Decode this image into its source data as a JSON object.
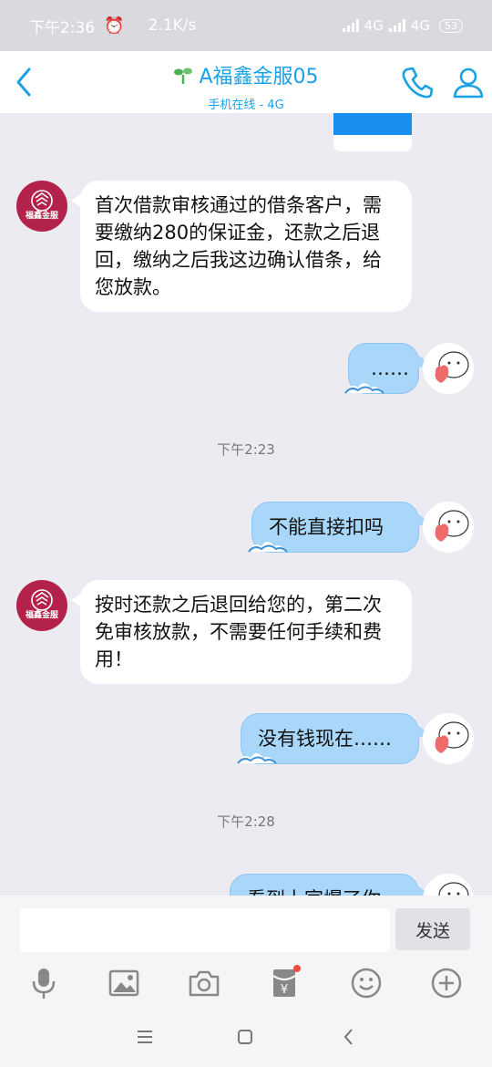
{
  "status_bar": {
    "time": "下午2:36",
    "speed": "2.1K/s",
    "signal1": "4G",
    "signal2": "4G",
    "battery": "53"
  },
  "header": {
    "title": "A福鑫金服05",
    "subtitle": "手机在线 - 4G"
  },
  "brand": {
    "avatar_text": "福鑫金服"
  },
  "messages": {
    "m1": "首次借款审核通过的借条客户，需要缴纳280的保证金，还款之后退回，缴纳之后我这边确认借条，给您放款。",
    "m2": "……",
    "t1": "下午2:23",
    "m3": "不能直接扣吗",
    "m4": "按时还款之后退回给您的，第二次免审核放款，不需要任何手续和费用！",
    "m5": "没有钱现在……",
    "t2": "下午2:28",
    "m6": "看到上官爆了你"
  },
  "input": {
    "placeholder": "",
    "value": "",
    "send_label": "发送"
  },
  "colors": {
    "accent": "#1aa1e6",
    "brand_red": "#b3224a",
    "bubble_out": "#a9d7fa"
  }
}
